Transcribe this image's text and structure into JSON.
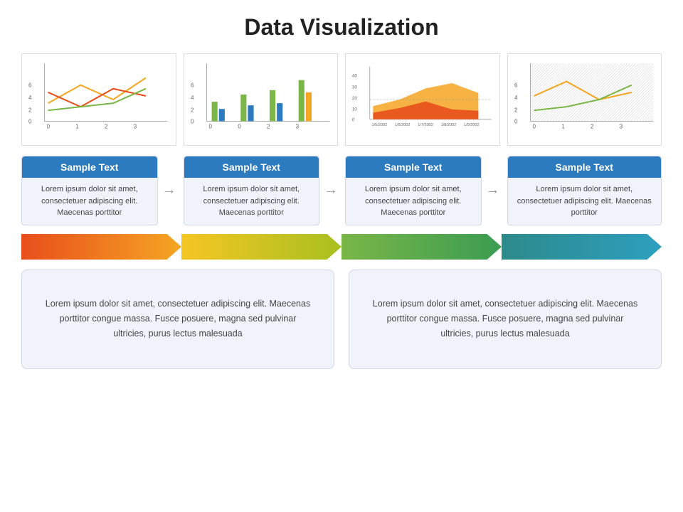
{
  "page": {
    "title": "Data Visualization",
    "cards": [
      {
        "header": "Sample Text",
        "body": "Lorem ipsum dolor sit amet, consectetuer adipiscing elit. Maecenas porttitor"
      },
      {
        "header": "Sample Text",
        "body": "Lorem ipsum dolor sit amet, consectetuer adipiscing elit. Maecenas porttitor"
      },
      {
        "header": "Sample Text",
        "body": "Lorem ipsum dolor sit amet, consectetuer adipiscing elit. Maecenas porttitor"
      },
      {
        "header": "Sample Text",
        "body": "Lorem ipsum dolor sit amet, consectetuer adipiscing elit. Maecenas porttitor"
      }
    ],
    "arrows": [
      {
        "color1": "#e84e1b",
        "color2": "#f5a623"
      },
      {
        "color1": "#f5a623",
        "color2": "#b8c13a"
      },
      {
        "color1": "#7ab648",
        "color2": "#3a9c52"
      },
      {
        "color1": "#2d8a8a",
        "color2": "#2d9fbf"
      }
    ],
    "bottom_boxes": [
      "Lorem ipsum dolor sit amet, consectetuer adipiscing elit. Maecenas porttitor congue massa. Fusce posuere, magna sed pulvinar ultricies, purus lectus malesuada",
      "Lorem ipsum dolor sit amet, consectetuer adipiscing elit. Maecenas porttitor congue massa. Fusce posuere, magna sed pulvinar ultricies, purus lectus malesuada"
    ]
  }
}
